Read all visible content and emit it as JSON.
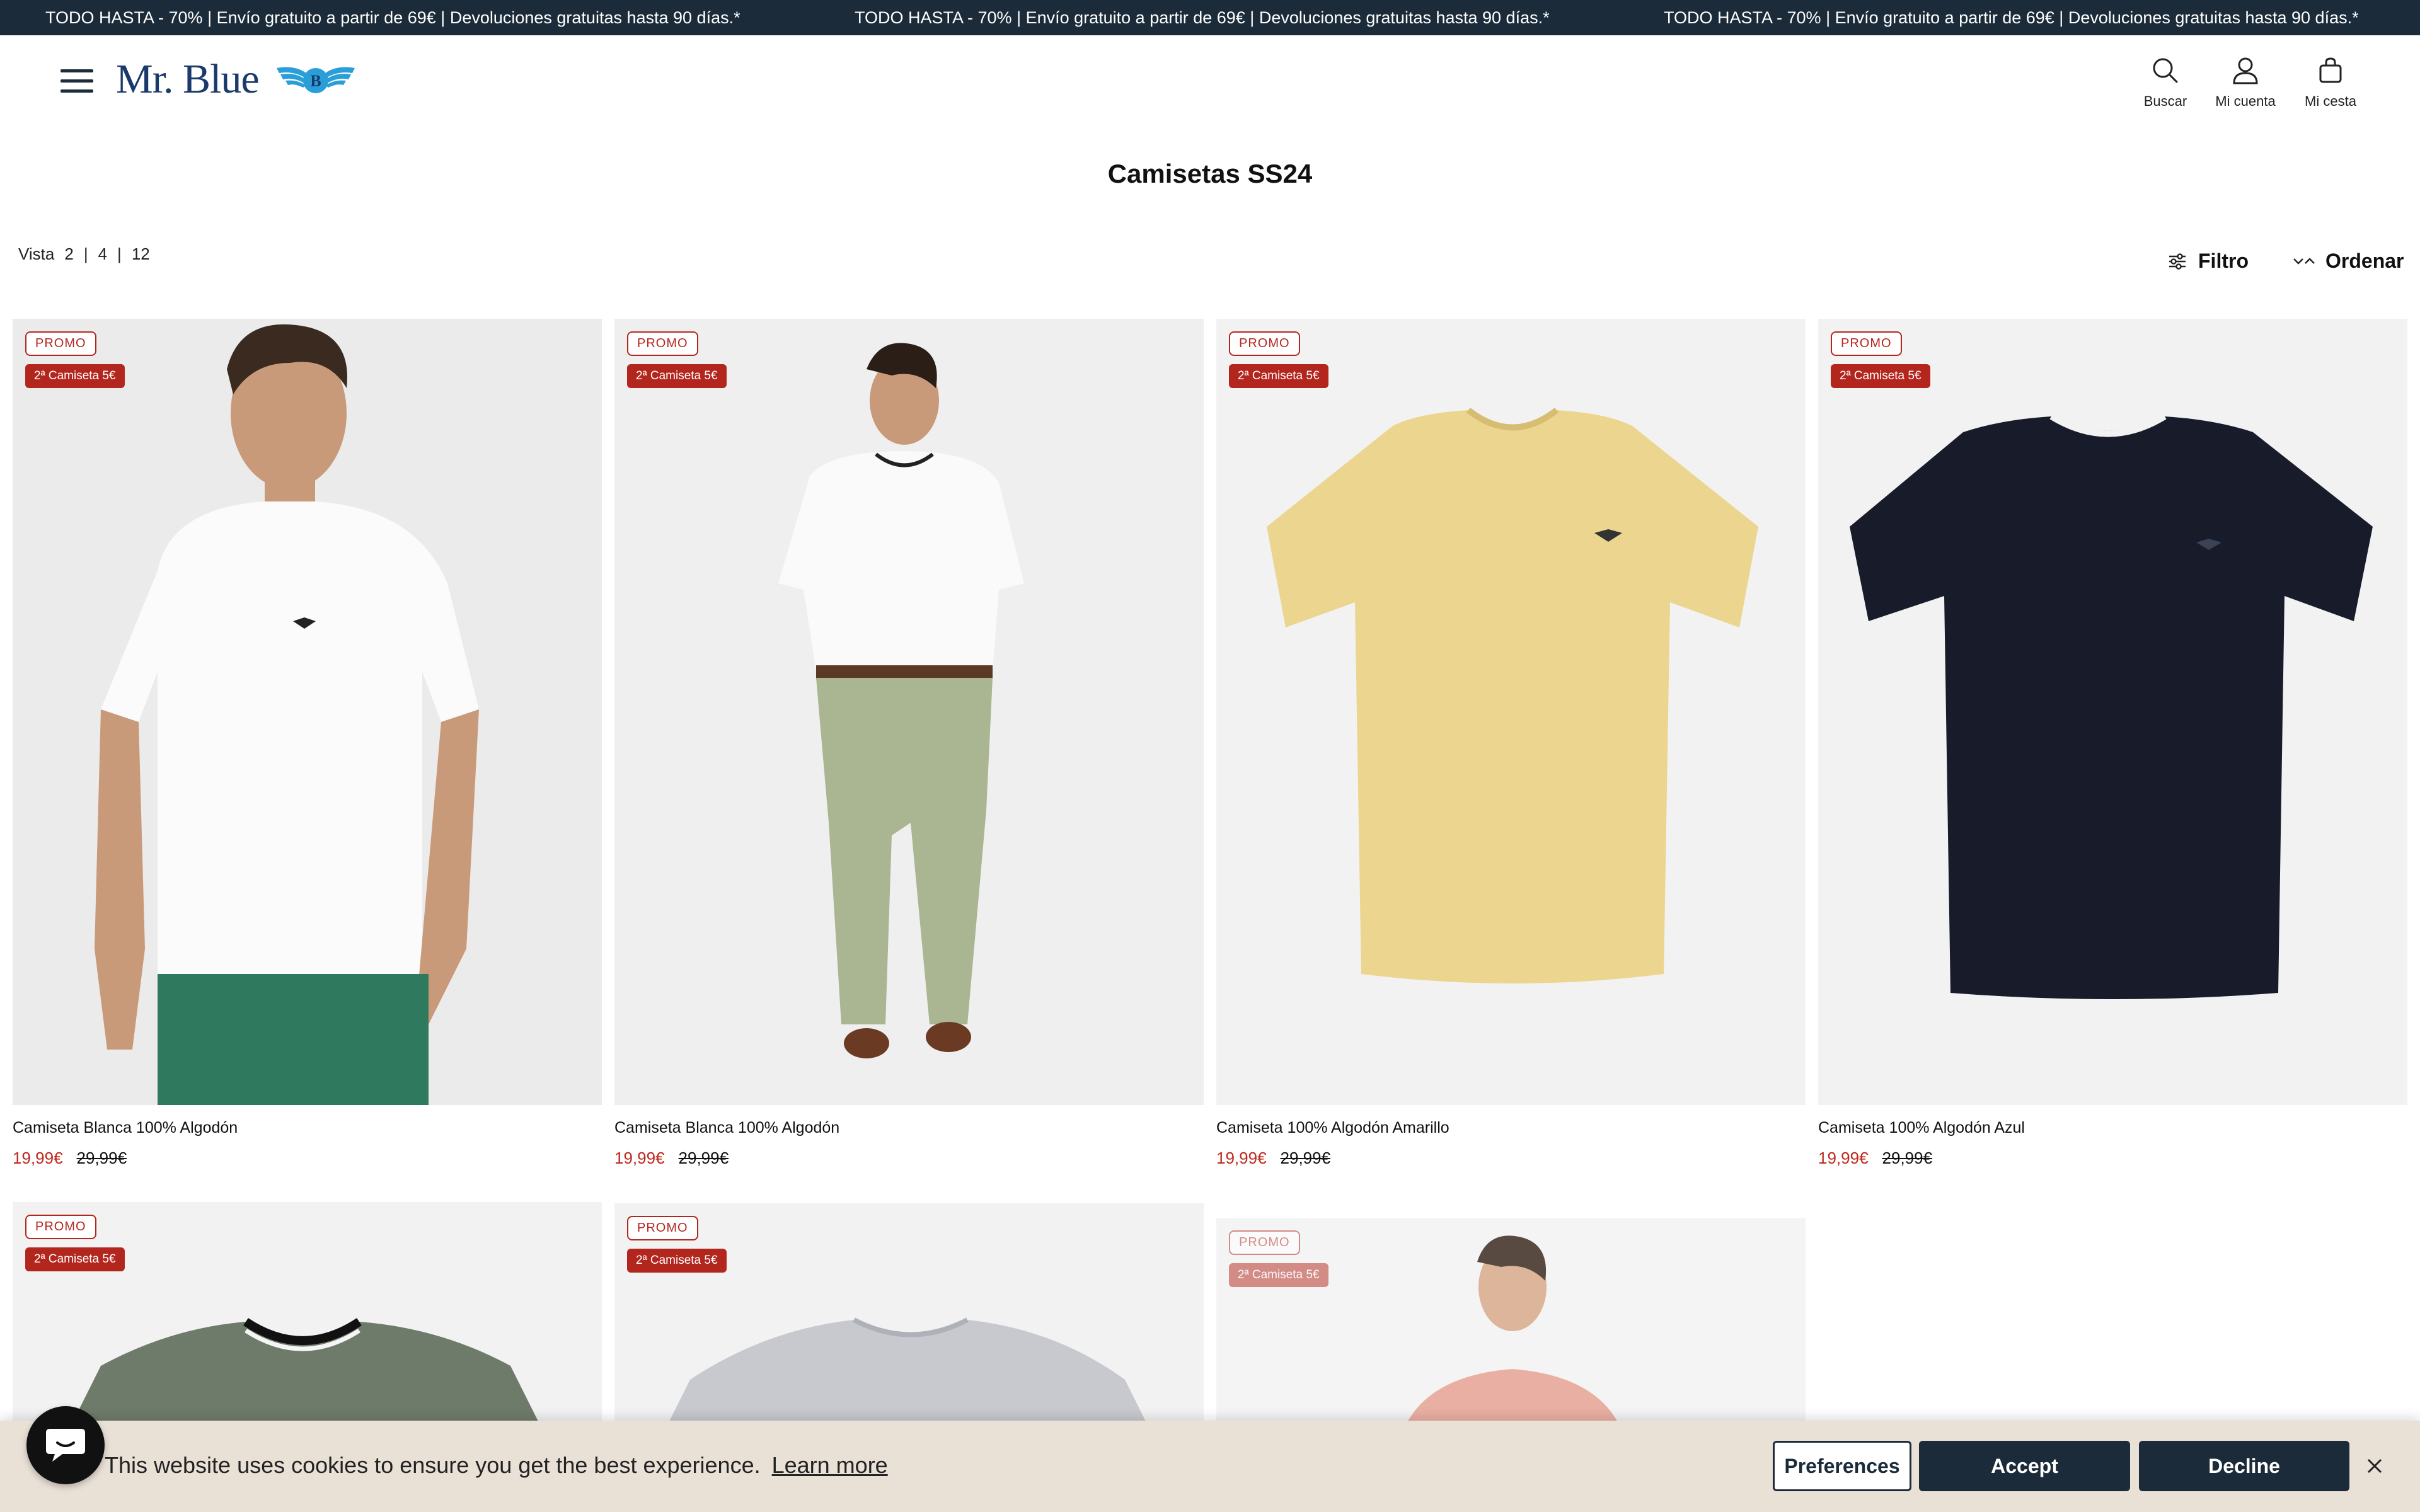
{
  "announcement": {
    "messages": [
      "TODO HASTA - 70% | Envío gratuito a partir de 69€ | Devoluciones gratuitas hasta 90 días.*",
      "TODO HASTA - 70% | Envío gratuito a partir de 69€ | Devoluciones gratuitas hasta 90 días.*",
      "TODO HASTA - 70% | Envío gratuito a partir de 69€ | Devoluciones gratuitas hasta 90 días.*"
    ]
  },
  "header": {
    "logo_text": "Mr. Blue",
    "logo_badge": "B",
    "search_label": "Buscar",
    "account_label": "Mi cuenta",
    "cart_label": "Mi cesta"
  },
  "page": {
    "title": "Camisetas SS24"
  },
  "toolbar": {
    "view_label": "Vista",
    "view_options": [
      "2",
      "4",
      "12"
    ],
    "separator": "|",
    "filter_label": "Filtro",
    "sort_label": "Ordenar"
  },
  "products": [
    {
      "promo": "PROMO",
      "deal": "2ª Camiseta 5€",
      "name": "Camiseta Blanca 100% Algodón",
      "price": "19,99€",
      "old_price": "29,99€"
    },
    {
      "promo": "PROMO",
      "deal": "2ª Camiseta 5€",
      "name": "Camiseta Blanca 100% Algodón",
      "price": "19,99€",
      "old_price": "29,99€"
    },
    {
      "promo": "PROMO",
      "deal": "2ª Camiseta 5€",
      "name": "Camiseta 100% Algodón Amarillo",
      "price": "19,99€",
      "old_price": "29,99€"
    },
    {
      "promo": "PROMO",
      "deal": "2ª Camiseta 5€",
      "name": "Camiseta 100% Algodón Azul",
      "price": "19,99€",
      "old_price": "29,99€"
    },
    {
      "promo": "PROMO",
      "deal": "2ª Camiseta 5€"
    },
    {
      "promo": "PROMO",
      "deal": "2ª Camiseta 5€"
    },
    {
      "promo": "PROMO",
      "deal": "2ª Camiseta 5€"
    }
  ],
  "cookie": {
    "message": "This website uses cookies to ensure you get the best experience.",
    "learn_more": "Learn more",
    "preferences": "Preferences",
    "accept": "Accept",
    "decline": "Decline"
  },
  "colors": {
    "brand_navy": "#1c2b39",
    "sale_red": "#c0261d",
    "cookie_bg": "#e9e0d6"
  },
  "icons": [
    "menu-icon",
    "search-icon",
    "user-icon",
    "bag-icon",
    "filter-icon",
    "sort-icon",
    "close-icon",
    "chat-icon"
  ]
}
